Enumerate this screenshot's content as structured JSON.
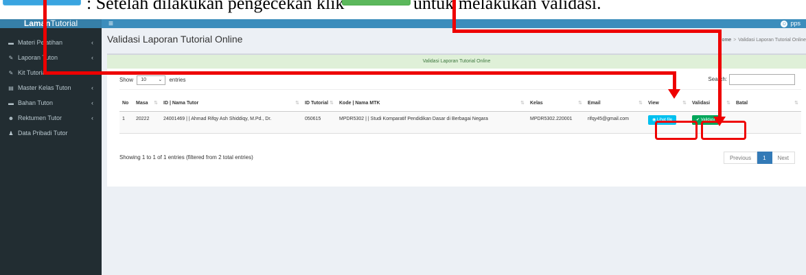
{
  "caption": {
    "text_before": ": Setelah dilakukan pengecekan klik",
    "text_after": "untuk melakukan validasi."
  },
  "app": {
    "brand_bold": "Laman",
    "brand_rest": "Tutorial",
    "menu_toggle": "≡",
    "username": "pps",
    "colors": {
      "topbar": "#3c8dbc",
      "sidebar": "#222d32",
      "annotation": "#e00000"
    }
  },
  "sidebar": {
    "items": [
      {
        "label": "Materi Pelatihan",
        "icon": "folder-icon",
        "glyph": "▬",
        "has_children": true
      },
      {
        "label": "Laporan Tuton",
        "icon": "pencil-icon",
        "glyph": "✎",
        "has_children": true
      },
      {
        "label": "Kit Tutorial",
        "icon": "pencil-icon",
        "glyph": "✎",
        "has_children": true
      },
      {
        "label": "Master Kelas Tuton",
        "icon": "book-icon",
        "glyph": "▤",
        "has_children": true
      },
      {
        "label": "Bahan Tuton",
        "icon": "folder-icon",
        "glyph": "▬",
        "has_children": true
      },
      {
        "label": "Rektumen Tutor",
        "icon": "users-icon",
        "glyph": "☻",
        "has_children": true
      },
      {
        "label": "Data Pribadi Tutor",
        "icon": "user-icon",
        "glyph": "♟",
        "has_children": false
      }
    ],
    "chevron": "‹"
  },
  "page": {
    "title": "Validasi Laporan Tutorial Online",
    "breadcrumb": {
      "home": "Home",
      "sep": ">",
      "current": "Validasi Laporan Tutorial Online"
    },
    "alert": "Validasi Laporan Tutorial Online"
  },
  "table_controls": {
    "show_label": "Show",
    "entries_value": "10",
    "entries_label": "entries",
    "search_label": "Search:"
  },
  "table": {
    "headers": [
      "No",
      "Masa",
      "ID | Nama Tutor",
      "ID Tutorial",
      "Kode | Nama MTK",
      "Kelas",
      "Email",
      "View",
      "Validasi",
      "Batal"
    ],
    "rows": [
      {
        "no": "1",
        "masa": "20222",
        "tutor": "24001469 | | Ahmad Rifqy Ash Shiddiqy, M.Pd., Dr.",
        "id_tutorial": "050615",
        "mtk": "MPDR5302 | | Studi Komparatif Pendidikan Dasar di Berbagai Negara",
        "kelas": "MPDR5302.220001",
        "email": "rifqy45@gmail.com",
        "view_button": "◉ Lihat file",
        "validasi_button": "✔ Validasi",
        "batal": ""
      }
    ]
  },
  "footer": {
    "info": "Showing 1 to 1 of 1 entries (filtered from 2 total entries)",
    "prev": "Previous",
    "page": "1",
    "next": "Next"
  }
}
